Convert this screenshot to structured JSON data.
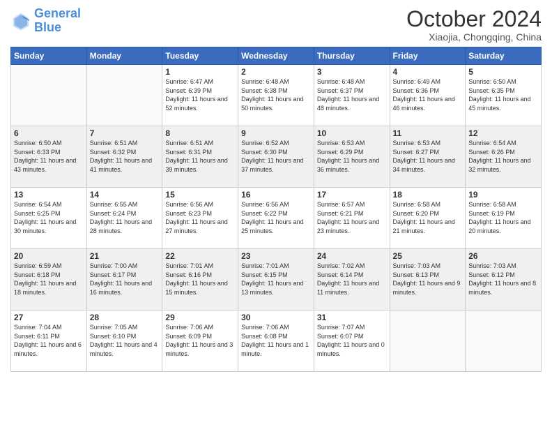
{
  "header": {
    "logo_line1": "General",
    "logo_line2": "Blue",
    "month": "October 2024",
    "location": "Xiaojia, Chongqing, China"
  },
  "weekdays": [
    "Sunday",
    "Monday",
    "Tuesday",
    "Wednesday",
    "Thursday",
    "Friday",
    "Saturday"
  ],
  "weeks": [
    [
      {
        "day": "",
        "info": ""
      },
      {
        "day": "",
        "info": ""
      },
      {
        "day": "1",
        "info": "Sunrise: 6:47 AM\nSunset: 6:39 PM\nDaylight: 11 hours and 52 minutes."
      },
      {
        "day": "2",
        "info": "Sunrise: 6:48 AM\nSunset: 6:38 PM\nDaylight: 11 hours and 50 minutes."
      },
      {
        "day": "3",
        "info": "Sunrise: 6:48 AM\nSunset: 6:37 PM\nDaylight: 11 hours and 48 minutes."
      },
      {
        "day": "4",
        "info": "Sunrise: 6:49 AM\nSunset: 6:36 PM\nDaylight: 11 hours and 46 minutes."
      },
      {
        "day": "5",
        "info": "Sunrise: 6:50 AM\nSunset: 6:35 PM\nDaylight: 11 hours and 45 minutes."
      }
    ],
    [
      {
        "day": "6",
        "info": "Sunrise: 6:50 AM\nSunset: 6:33 PM\nDaylight: 11 hours and 43 minutes."
      },
      {
        "day": "7",
        "info": "Sunrise: 6:51 AM\nSunset: 6:32 PM\nDaylight: 11 hours and 41 minutes."
      },
      {
        "day": "8",
        "info": "Sunrise: 6:51 AM\nSunset: 6:31 PM\nDaylight: 11 hours and 39 minutes."
      },
      {
        "day": "9",
        "info": "Sunrise: 6:52 AM\nSunset: 6:30 PM\nDaylight: 11 hours and 37 minutes."
      },
      {
        "day": "10",
        "info": "Sunrise: 6:53 AM\nSunset: 6:29 PM\nDaylight: 11 hours and 36 minutes."
      },
      {
        "day": "11",
        "info": "Sunrise: 6:53 AM\nSunset: 6:27 PM\nDaylight: 11 hours and 34 minutes."
      },
      {
        "day": "12",
        "info": "Sunrise: 6:54 AM\nSunset: 6:26 PM\nDaylight: 11 hours and 32 minutes."
      }
    ],
    [
      {
        "day": "13",
        "info": "Sunrise: 6:54 AM\nSunset: 6:25 PM\nDaylight: 11 hours and 30 minutes."
      },
      {
        "day": "14",
        "info": "Sunrise: 6:55 AM\nSunset: 6:24 PM\nDaylight: 11 hours and 28 minutes."
      },
      {
        "day": "15",
        "info": "Sunrise: 6:56 AM\nSunset: 6:23 PM\nDaylight: 11 hours and 27 minutes."
      },
      {
        "day": "16",
        "info": "Sunrise: 6:56 AM\nSunset: 6:22 PM\nDaylight: 11 hours and 25 minutes."
      },
      {
        "day": "17",
        "info": "Sunrise: 6:57 AM\nSunset: 6:21 PM\nDaylight: 11 hours and 23 minutes."
      },
      {
        "day": "18",
        "info": "Sunrise: 6:58 AM\nSunset: 6:20 PM\nDaylight: 11 hours and 21 minutes."
      },
      {
        "day": "19",
        "info": "Sunrise: 6:58 AM\nSunset: 6:19 PM\nDaylight: 11 hours and 20 minutes."
      }
    ],
    [
      {
        "day": "20",
        "info": "Sunrise: 6:59 AM\nSunset: 6:18 PM\nDaylight: 11 hours and 18 minutes."
      },
      {
        "day": "21",
        "info": "Sunrise: 7:00 AM\nSunset: 6:17 PM\nDaylight: 11 hours and 16 minutes."
      },
      {
        "day": "22",
        "info": "Sunrise: 7:01 AM\nSunset: 6:16 PM\nDaylight: 11 hours and 15 minutes."
      },
      {
        "day": "23",
        "info": "Sunrise: 7:01 AM\nSunset: 6:15 PM\nDaylight: 11 hours and 13 minutes."
      },
      {
        "day": "24",
        "info": "Sunrise: 7:02 AM\nSunset: 6:14 PM\nDaylight: 11 hours and 11 minutes."
      },
      {
        "day": "25",
        "info": "Sunrise: 7:03 AM\nSunset: 6:13 PM\nDaylight: 11 hours and 9 minutes."
      },
      {
        "day": "26",
        "info": "Sunrise: 7:03 AM\nSunset: 6:12 PM\nDaylight: 11 hours and 8 minutes."
      }
    ],
    [
      {
        "day": "27",
        "info": "Sunrise: 7:04 AM\nSunset: 6:11 PM\nDaylight: 11 hours and 6 minutes."
      },
      {
        "day": "28",
        "info": "Sunrise: 7:05 AM\nSunset: 6:10 PM\nDaylight: 11 hours and 4 minutes."
      },
      {
        "day": "29",
        "info": "Sunrise: 7:06 AM\nSunset: 6:09 PM\nDaylight: 11 hours and 3 minutes."
      },
      {
        "day": "30",
        "info": "Sunrise: 7:06 AM\nSunset: 6:08 PM\nDaylight: 11 hours and 1 minute."
      },
      {
        "day": "31",
        "info": "Sunrise: 7:07 AM\nSunset: 6:07 PM\nDaylight: 11 hours and 0 minutes."
      },
      {
        "day": "",
        "info": ""
      },
      {
        "day": "",
        "info": ""
      }
    ]
  ]
}
